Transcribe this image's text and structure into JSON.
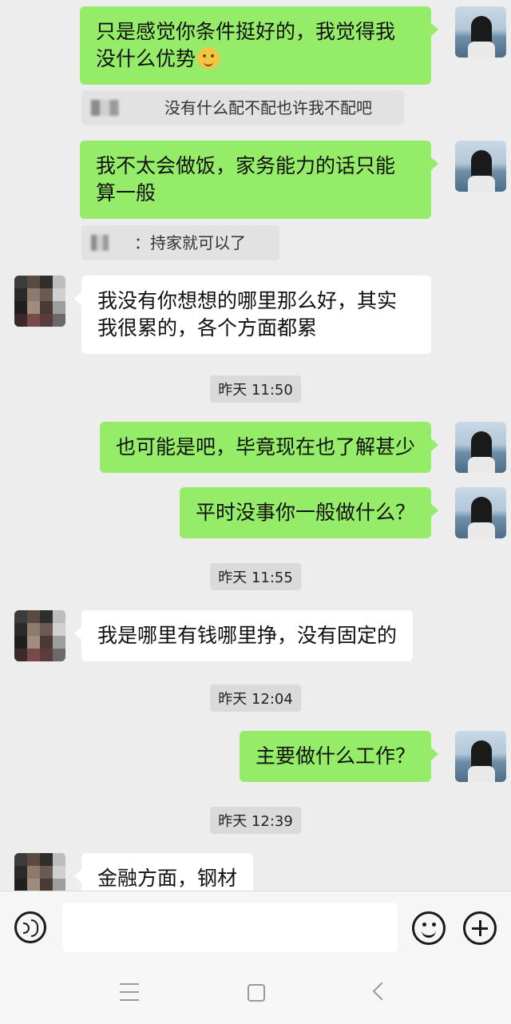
{
  "chat": {
    "messages": [
      {
        "side": "me",
        "text_lines": [
          "只是感觉你条件挺好的，我觉得我",
          "没什么优势"
        ],
        "emoji": "thinking-face"
      },
      {
        "type": "quote",
        "text": "没有什么配不配也许我不配吧"
      },
      {
        "side": "me",
        "text_lines": [
          "我不太会做饭，家务能力的话只能",
          "算一般"
        ]
      },
      {
        "type": "quote",
        "text": "：持家就可以了"
      },
      {
        "side": "other",
        "text_lines": [
          "我没有你想想的哪里那么好，其实",
          "我很累的，各个方面都累"
        ]
      },
      {
        "type": "time",
        "text": "昨天 11:50"
      },
      {
        "side": "me",
        "text": "也可能是吧，毕竟现在也了解甚少"
      },
      {
        "side": "me",
        "text": "平时没事你一般做什么？"
      },
      {
        "type": "time",
        "text": "昨天 11:55"
      },
      {
        "side": "other",
        "text": "我是哪里有钱哪里挣，没有固定的"
      },
      {
        "type": "time",
        "text": "昨天 12:04"
      },
      {
        "side": "me",
        "text": "主要做什么工作？"
      },
      {
        "type": "time",
        "text": "昨天 12:39"
      },
      {
        "side": "other",
        "text": "金融方面，钢材"
      }
    ]
  },
  "input_bar": {
    "voice_icon": "voice-icon",
    "emoji_icon": "emoji-icon",
    "plus_icon": "plus-icon",
    "text_value": ""
  },
  "nav_bar": {
    "icons": [
      "menu-icon",
      "home-icon",
      "back-icon"
    ]
  },
  "colors": {
    "background": "#ededed",
    "my_bubble": "#95ec69",
    "other_bubble": "#ffffff"
  }
}
